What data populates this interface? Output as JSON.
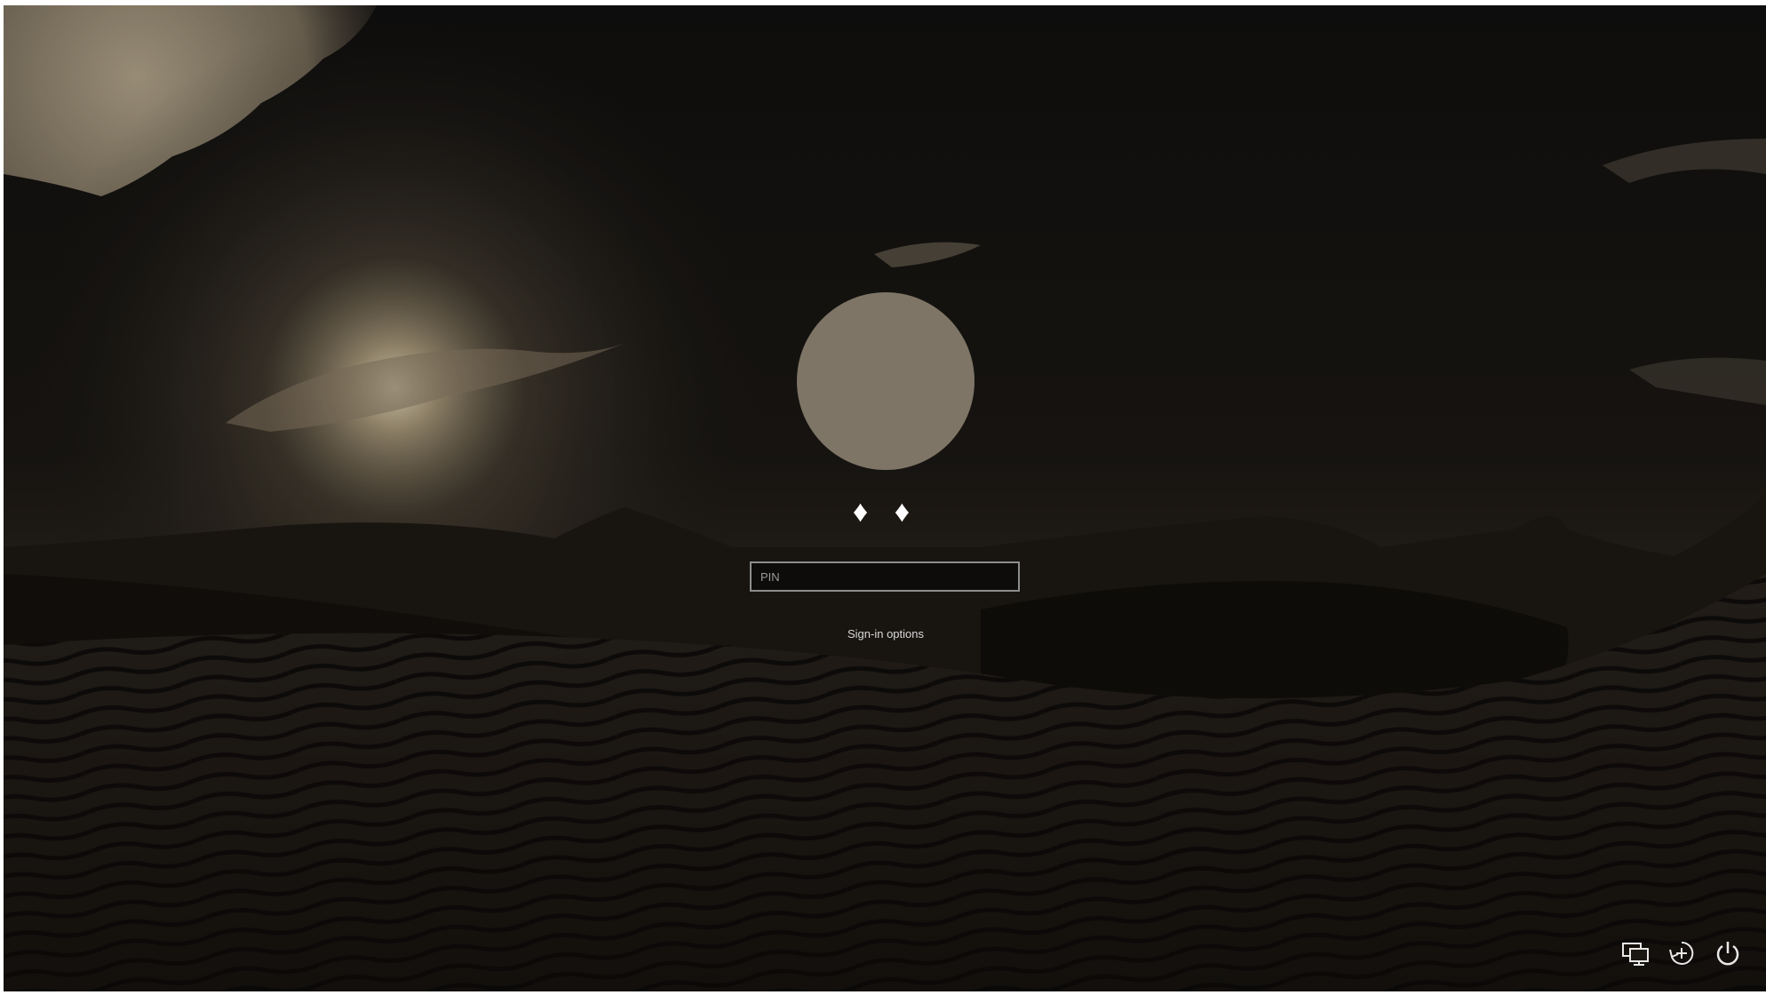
{
  "lock_screen": {
    "user_name": "♦ ♦",
    "pin_field": {
      "placeholder": "PIN",
      "value": ""
    },
    "sign_in_options_label": "Sign-in options"
  },
  "corner_icons": [
    "network-icon",
    "accessibility-icon",
    "power-icon"
  ],
  "colors": {
    "avatar": "#7e7566",
    "text": "#ffffff",
    "field_border": "#8d8d8d"
  }
}
